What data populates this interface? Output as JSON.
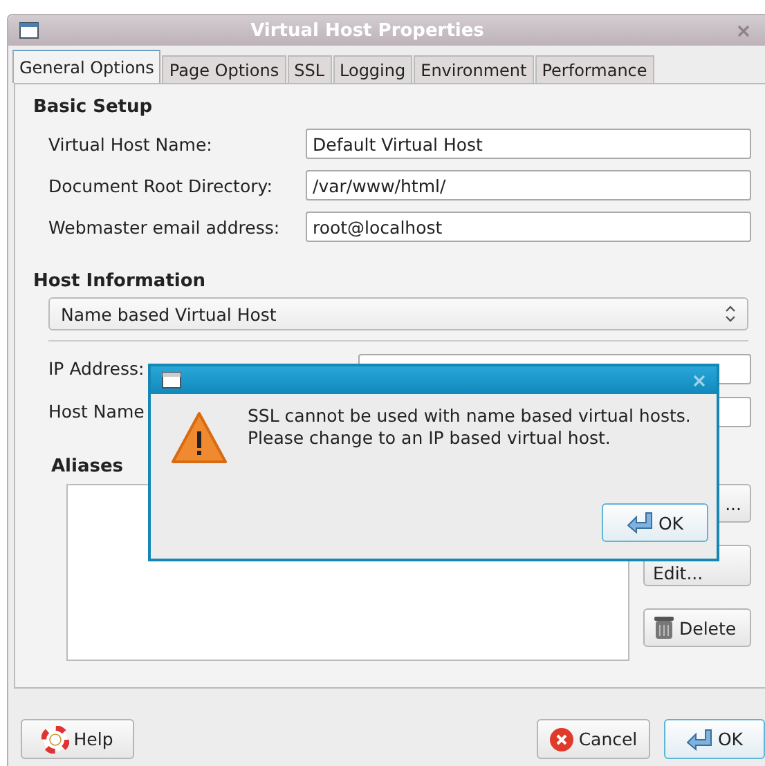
{
  "window": {
    "title": "Virtual Host Properties"
  },
  "tabs": [
    {
      "label": "General Options",
      "selected": true
    },
    {
      "label": "Page Options",
      "selected": false
    },
    {
      "label": "SSL",
      "selected": false
    },
    {
      "label": "Logging",
      "selected": false
    },
    {
      "label": "Environment",
      "selected": false
    },
    {
      "label": "Performance",
      "selected": false
    }
  ],
  "basic_setup": {
    "heading": "Basic Setup",
    "fields": [
      {
        "label": "Virtual Host Name:",
        "value": "Default Virtual Host"
      },
      {
        "label": "Document Root Directory:",
        "value": "/var/www/html/"
      },
      {
        "label": "Webmaster email address:",
        "value": "root@localhost"
      }
    ]
  },
  "host_information": {
    "heading": "Host Information",
    "type_select": "Name based Virtual Host",
    "fields": [
      {
        "label": "IP Address:"
      },
      {
        "label": "Host Name"
      }
    ]
  },
  "aliases": {
    "heading": "Aliases",
    "buttons": [
      "...",
      "Edit...",
      "Delete"
    ]
  },
  "buttons": {
    "help": "Help",
    "cancel": "Cancel",
    "ok": "OK"
  },
  "dialog": {
    "message": [
      "SSL cannot be used with name based virtual hosts.",
      "Please change to an IP based virtual host."
    ],
    "ok": "OK"
  }
}
